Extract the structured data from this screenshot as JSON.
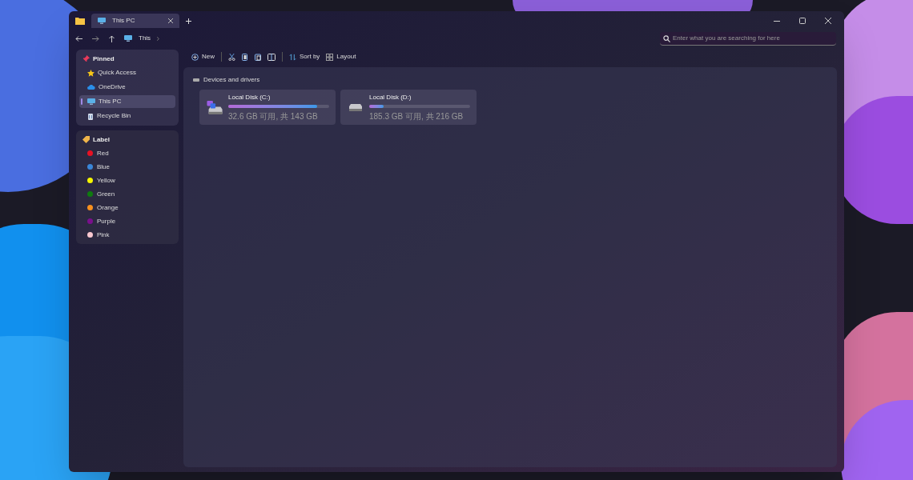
{
  "window": {
    "tabs": [
      {
        "label": "This PC",
        "selected": true
      }
    ],
    "breadcrumb": [
      "This"
    ],
    "search": {
      "placeholder": "Enter what you are searching for here"
    }
  },
  "toolbar": [
    {
      "kind": "new",
      "label": "New"
    },
    {
      "kind": "cut"
    },
    {
      "kind": "copy"
    },
    {
      "kind": "paste"
    },
    {
      "kind": "rename"
    },
    {
      "kind": "sort",
      "label": "Sort by"
    },
    {
      "kind": "layout",
      "label": "Layout"
    }
  ],
  "sidebar": {
    "pinned": {
      "title": "Pinned",
      "items": [
        {
          "label": "Quick Access",
          "kind": "star",
          "selected": false
        },
        {
          "label": "OneDrive",
          "kind": "cloud",
          "selected": false
        },
        {
          "label": "This PC",
          "kind": "computer",
          "selected": true
        },
        {
          "label": "Recycle Bin",
          "kind": "bin",
          "selected": false
        }
      ]
    },
    "labels": {
      "title": "Label",
      "items": [
        {
          "label": "Red",
          "color": "#e81123"
        },
        {
          "label": "Blue",
          "color": "#3a86d8"
        },
        {
          "label": "Yellow",
          "color": "#f5f500"
        },
        {
          "label": "Green",
          "color": "#0f7b0f"
        },
        {
          "label": "Orange",
          "color": "#f7901e"
        },
        {
          "label": "Purple",
          "color": "#7a0f8c"
        },
        {
          "label": "Pink",
          "color": "#f9c8d0"
        }
      ]
    }
  },
  "content": {
    "section": "Devices and drivers",
    "drives": [
      {
        "name": "Local Disk (C:)",
        "kind": "system",
        "level": 0.88,
        "usage": "32.6 GB 可用, 共 143 GB"
      },
      {
        "name": "Local Disk (D:)",
        "kind": "data",
        "level": 0.14,
        "usage": "185.3 GB 可用, 共 216 GB"
      }
    ]
  }
}
